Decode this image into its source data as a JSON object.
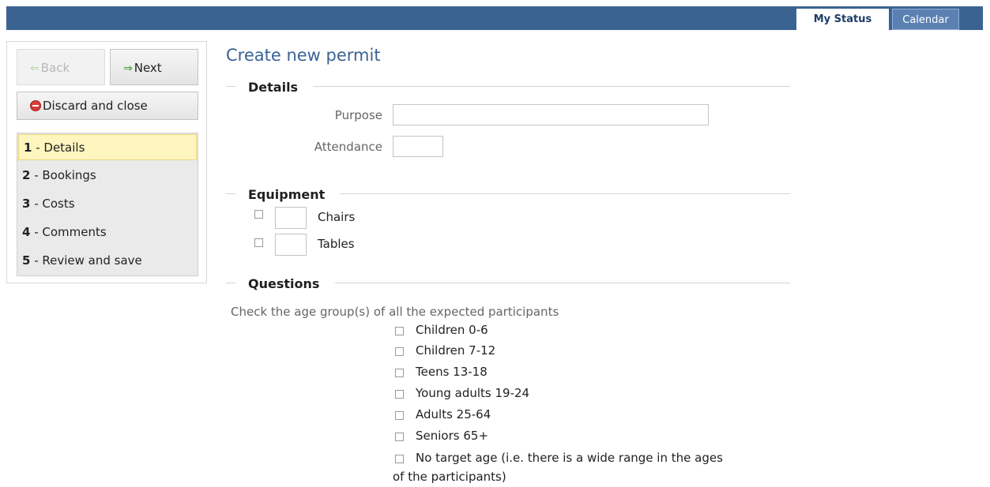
{
  "top_tabs": {
    "my_status": "My Status",
    "calendar": "Calendar"
  },
  "nav": {
    "back": "Back",
    "next": "Next",
    "discard": "Discard and close"
  },
  "steps": [
    {
      "num": "1",
      "label": "Details"
    },
    {
      "num": "2",
      "label": "Bookings"
    },
    {
      "num": "3",
      "label": "Costs"
    },
    {
      "num": "4",
      "label": "Comments"
    },
    {
      "num": "5",
      "label": "Review and save"
    }
  ],
  "page_title": "Create new permit",
  "details": {
    "heading": "Details",
    "purpose_label": "Purpose",
    "purpose_value": "",
    "attendance_label": "Attendance",
    "attendance_value": ""
  },
  "equipment": {
    "heading": "Equipment",
    "items": [
      {
        "label": "Chairs",
        "checked": false,
        "qty": ""
      },
      {
        "label": "Tables",
        "checked": false,
        "qty": ""
      }
    ]
  },
  "questions": {
    "heading": "Questions",
    "prompt": "Check the age group(s) of all the expected participants",
    "age_groups": [
      {
        "label": "Children 0-6",
        "checked": false
      },
      {
        "label": "Children 7-12",
        "checked": false
      },
      {
        "label": "Teens 13-18",
        "checked": false
      },
      {
        "label": "Young adults 19-24",
        "checked": false
      },
      {
        "label": "Adults 25-64",
        "checked": false
      },
      {
        "label": "Seniors 65+",
        "checked": false
      },
      {
        "label": "No target age (i.e. there is a wide range in the ages",
        "checked": false
      }
    ],
    "no_target_continuation": "of the participants)"
  },
  "colors": {
    "topbar": "#3b6391",
    "title": "#3a6396",
    "active_step": "#fff5bf"
  }
}
